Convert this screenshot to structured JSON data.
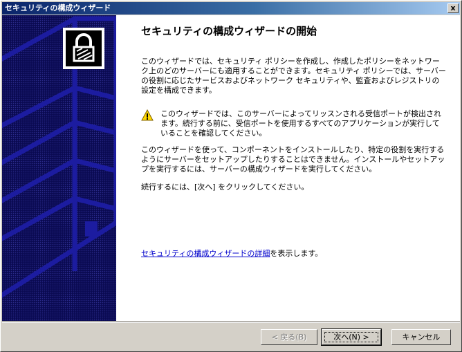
{
  "window": {
    "title": "セキュリティの構成ウィザード",
    "close_label": "x"
  },
  "main": {
    "heading": "セキュリティの構成ウィザードの開始",
    "intro": "このウィザードでは、セキュリティ ポリシーを作成し、作成したポリシーをネットワーク上のどのサーバーにも適用することができます。セキュリティ ポリシーでは、サーバーの役割に応じたサービスおよびネットワーク セキュリティや、監査およびレジストリの設定を構成できます。",
    "warning": "このウィザードでは、このサーバーによってリッスンされる受信ポートが検出されます。続行する前に、受信ポートを使用するすべてのアプリケーションが実行していることを確認してください。",
    "component_note": "このウィザードを使って、コンポーネントをインストールしたり、特定の役割を実行するようにサーバーをセットアップしたりすることはできません。インストールやセットアップを実行するには、サーバーの構成ウィザードを実行してください。",
    "continue_note": "続行するには、[次へ] をクリックしてください。",
    "details_link": "セキュリティの構成ウィザードの詳細",
    "details_suffix": "を表示します。"
  },
  "buttons": {
    "back": "< 戻る(B)",
    "next": "次へ(N) >",
    "cancel": "キャンセル"
  },
  "icons": {
    "logo": "padlock-icon",
    "warning": "warning-icon"
  },
  "colors": {
    "title_start": "#0a246a",
    "title_end": "#a6caf0",
    "side_panel": "#0a0a52",
    "link": "#0000cc"
  }
}
